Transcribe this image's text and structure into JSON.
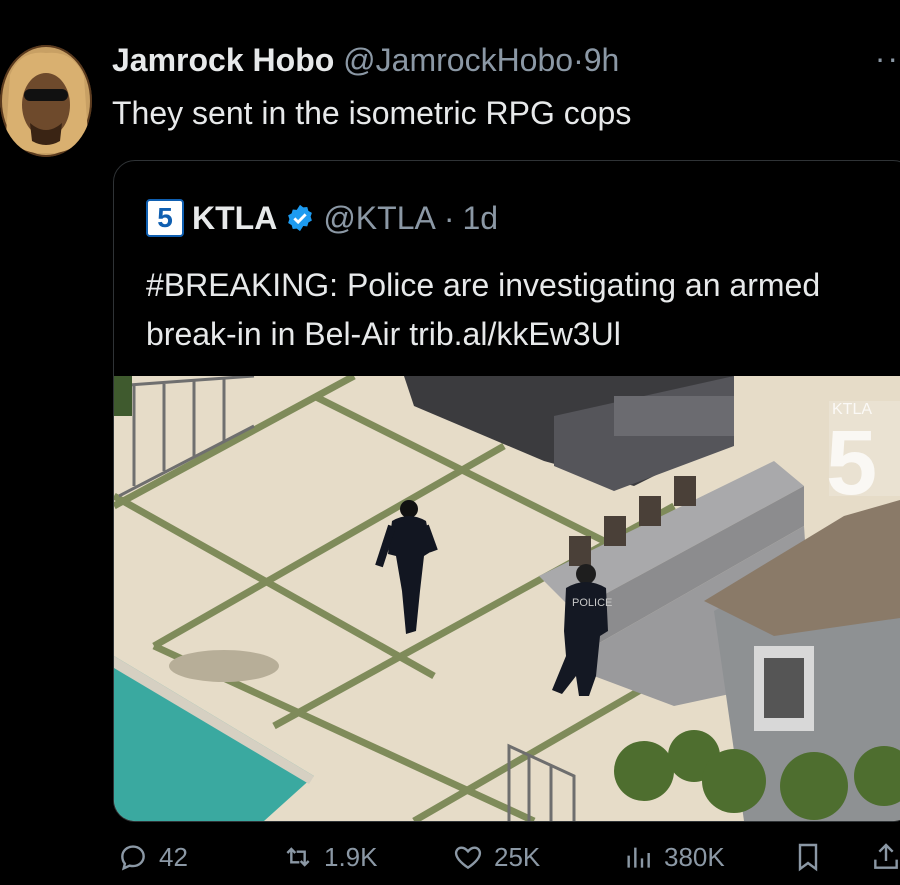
{
  "tweet": {
    "display_name": "Jamrock Hobo",
    "handle": "@JamrockHobo",
    "separator": "·",
    "time": "9h",
    "text": "They sent in the isometric RPG cops",
    "more_icon": "more-dots-icon"
  },
  "quoted": {
    "logo_text": "5",
    "display_name": "KTLA",
    "handle": "@KTLA",
    "separator": "·",
    "time": "1d",
    "text": "#BREAKING: Police are investigating an armed break-in in Bel-Air trib.al/kkEw3Ul",
    "photo_watermark": "5",
    "photo_watermark_small": "KTLA"
  },
  "actions": {
    "replies": "42",
    "reposts": "1.9K",
    "likes": "25K",
    "views": "380K"
  },
  "colors": {
    "background": "#000000",
    "text": "#e7e9ea",
    "secondary": "#8b98a5",
    "verified": "#1d9bf0",
    "border": "#2f3336"
  }
}
